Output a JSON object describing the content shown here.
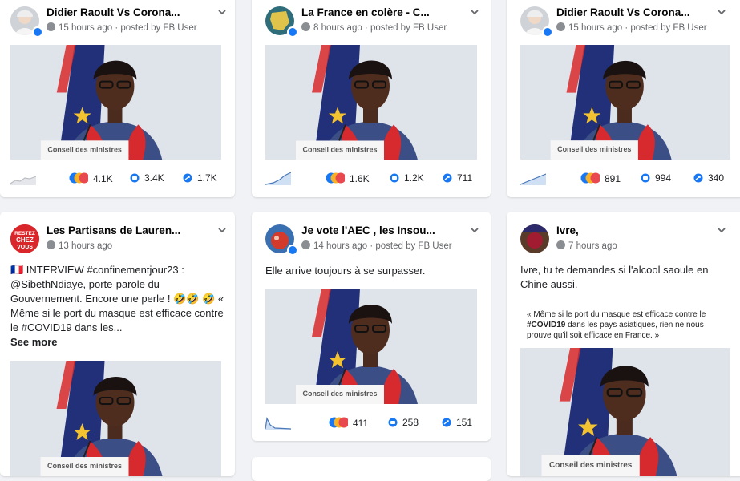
{
  "colors": {
    "brand": "#1877f2",
    "muted": "#65676b",
    "bg": "#f0f2f5"
  },
  "cards": [
    {
      "title": "Didier Raoult Vs Corona...",
      "meta": "15 hours ago · posted by FB User",
      "likes": "4.1K",
      "comments": "3.4K",
      "shares": "1.7K",
      "media_label": "Conseil des ministres",
      "avatar": "raoult-avatar"
    },
    {
      "title": "La France en colère - C...",
      "meta": "8 hours ago · posted by FB User",
      "likes": "1.6K",
      "comments": "1.2K",
      "shares": "711",
      "media_label": "Conseil des ministres",
      "avatar": "france-map-avatar"
    },
    {
      "title": "Didier Raoult Vs Corona...",
      "meta": "15 hours ago · posted by FB User",
      "likes": "891",
      "comments": "994",
      "shares": "340",
      "media_label": "Conseil des ministres",
      "avatar": "raoult-avatar"
    },
    {
      "title": "Les Partisans de Lauren...",
      "meta": "13 hours ago",
      "text": "🇫🇷 INTERVIEW #confinementjour23 : @SibethNdiaye, porte-parole du Gouvernement. Encore une perle ! 🤣🤣 🤣 « Même si le port du masque est efficace contre le #COVID19 dans les...",
      "see_more": "See more",
      "media_label": "Conseil des ministres",
      "avatar_text": "RESTEZ CHEZ VOUS"
    },
    {
      "title": "Je vote l'AEC , les Insou...",
      "meta": "14 hours ago · posted by FB User",
      "text": "Elle arrive toujours à se surpasser.",
      "likes": "411",
      "comments": "258",
      "shares": "151",
      "media_label": "Conseil des ministres",
      "avatar": "aec-avatar"
    },
    {
      "title": "Ivre,",
      "meta": "7 hours ago",
      "text": "Ivre, tu te demandes si l'alcool saoule en Chine aussi.",
      "caption_pre": "« Même si le port du masque est efficace contre le ",
      "caption_tag": "#COVID19",
      "caption_post": " dans les pays asiatiques, rien ne nous prouve qu'il soit efficace en France. »",
      "media_label": "Conseil des ministres",
      "avatar": "ivre-avatar"
    }
  ]
}
